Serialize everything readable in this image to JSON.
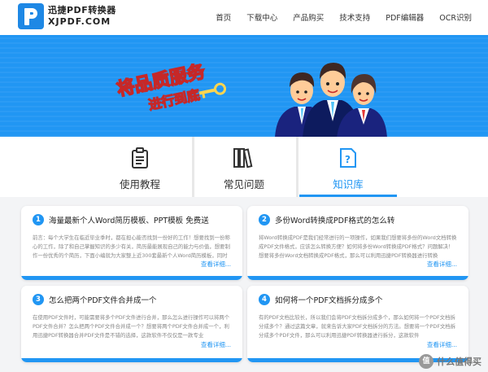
{
  "brand": {
    "name_cn": "迅捷PDF转换器",
    "domain": "XJPDF.COM"
  },
  "nav": [
    "首页",
    "下载中心",
    "产品购买",
    "技术支持",
    "PDF编辑器",
    "OCR识别"
  ],
  "banner": {
    "slogan_line1": "将品质服务",
    "slogan_line2": "进行到底"
  },
  "tabs": [
    {
      "label": "使用教程",
      "icon": "clipboard-icon",
      "active": false
    },
    {
      "label": "常见问题",
      "icon": "books-icon",
      "active": false
    },
    {
      "label": "知识库",
      "icon": "question-doc-icon",
      "active": true
    }
  ],
  "cards": [
    {
      "number": "1",
      "title": "海量最新个人Word简历模板、PPT模板 免费送",
      "body": "前言：每个大学生在临近毕业季时，都在担心能否找到一份好的工作！想要找到一份称心的工作，除了和自己掌握知识的多少有关，简历最能展现自己的能力与价值，想要制作一份优秀的个简历，下面小编就为大家整上近300套最新个人Word简历模板，同时为已经步",
      "more": "查看详细..."
    },
    {
      "number": "2",
      "title": "多份Word转换成PDF格式的怎么转",
      "body": "将Word转换成PDF是我们经常进行的一项操作，如果我们想要将多份的Word文档转换成PDF文件格式，应该怎么转换方便？如何将多份Word转换成PDF格式？问题解决！想要将多份Word文档转换成PDF格式，那么可以利用迅捷PDF转换器进行转换",
      "more": "查看详细..."
    },
    {
      "number": "3",
      "title": "怎么把两个PDF文件合并成一个",
      "body": "在使用PDF文件时，可能需要将多个PDF文件进行合并，那么怎么进行操作可以将两个PDF文件合并？怎么把两个PDF文件合并成一个？想要将两个PDF文件合并成一个，利用迅捷PDF转换器合并PDF文件是不错的选择，这款软件不仅仅是一款专业",
      "more": "查看详细..."
    },
    {
      "number": "4",
      "title": "如何将一个PDF文档拆分成多个",
      "body": "有的PDF文档比较长，所以我们会将PDF文档拆分成多个，那么如何将一个PDF文档拆分成多个？通过这篇文章，就来告诉大家PDF文档拆分的方法。想要将一个PDF文档拆分成多个PDF文件，那么可以利用迅捷PDF转换器进行拆分，这款软件",
      "more": "查看详细..."
    }
  ],
  "watermark": {
    "symbol": "值",
    "text": "什么值得买"
  }
}
